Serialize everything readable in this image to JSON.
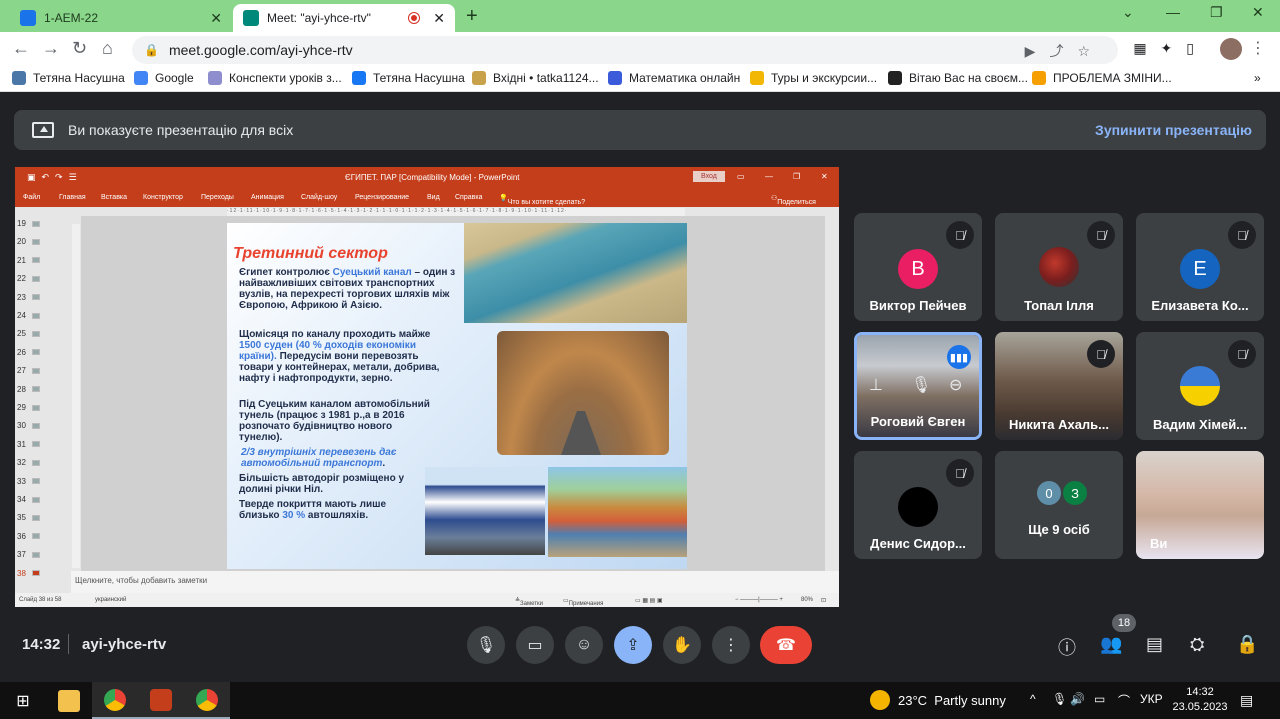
{
  "browser": {
    "tabs": [
      {
        "title": "1-АЕМ-22",
        "color": "#1a73e8"
      },
      {
        "title": "Meet: \"ayi-yhce-rtv\"",
        "color": "#00897b"
      }
    ],
    "url": "meet.google.com/ayi-yhce-rtv",
    "bookmarks": [
      {
        "label": "Тетяна Насушна",
        "color": "#4a76a8"
      },
      {
        "label": "Google",
        "color": "#4285f4"
      },
      {
        "label": "Конспекти уроків з...",
        "color": "#8e8ecf"
      },
      {
        "label": "Тетяна Насушна",
        "color": "#1877f2"
      },
      {
        "label": "Вхідні • tatka1124...",
        "color": "#c8a24a"
      },
      {
        "label": "Математика онлайн",
        "color": "#3b5bdb"
      },
      {
        "label": "Туры и экскурсии...",
        "color": "#f2b705"
      },
      {
        "label": "Вітаю Вас на своєм...",
        "color": "#222222"
      },
      {
        "label": "ПРОБЛЕМА ЗМІНИ...",
        "color": "#f59f00"
      }
    ],
    "bookmarks_more": "»"
  },
  "meet": {
    "banner_text": "Ви показуєте презентацію для всіх",
    "stop_label": "Зупинити презентацію",
    "time": "14:32",
    "meeting_code": "ayi-yhce-rtv",
    "people_count": "18",
    "participants": [
      {
        "name": "Виктор Пейчев",
        "initial": "В",
        "color": "#e91e63"
      },
      {
        "name": "Топал Ілля"
      },
      {
        "name": "Елизавета Ко...",
        "initial": "Е",
        "color": "#1565c0"
      },
      {
        "name": "Роговий Євген"
      },
      {
        "name": "Никита Ахаль..."
      },
      {
        "name": "Вадим Хімей..."
      },
      {
        "name": "Денис Сидор..."
      },
      {
        "name": "Ще 9 осіб",
        "more": [
          "0",
          "З"
        ]
      },
      {
        "name": "Ви"
      }
    ]
  },
  "ppt": {
    "window_title": "ЄГИПЕТ. ПАР [Compatibility Mode] - PowerPoint",
    "login": "Вход",
    "ribbon": [
      "Файл",
      "Главная",
      "Вставка",
      "Конструктор",
      "Переходы",
      "Анимация",
      "Слайд-шоу",
      "Рецензирование",
      "Вид",
      "Справка",
      "Что вы хотите сделать?",
      "Поделиться"
    ],
    "thumb_numbers": [
      "19",
      "20",
      "21",
      "22",
      "23",
      "24",
      "25",
      "26",
      "27",
      "28",
      "29",
      "30",
      "31",
      "32",
      "33",
      "34",
      "35",
      "36",
      "37",
      "38"
    ],
    "notes_placeholder": "Щелкните, чтобы добавить заметки",
    "status_left": "Слайд 38 из 58",
    "status_lang": "украинский",
    "status_notes": "Заметки",
    "status_comments": "Примечания",
    "zoom": "80%",
    "slide": {
      "title": "Третинний сектор",
      "p1_a": "Єгипет контролює ",
      "p1_hl": "Суецький канал",
      "p1_b": " – один з найважливіших світових транспортних вузлів, на перехресті торгових шляхів між Європою, Африкою й Азією.",
      "p2_a": "Щомісяця по каналу проходить майже ",
      "p2_hl": "1500 суден (40 % доходів економіки країни).",
      "p2_b": " Передусім вони перевозять товари у контейнерах, метали, добрива, нафту і нафтопродукти, зерно.",
      "p3": "Під Суецьким каналом автомобільний тунель (працює з 1981 р.,а в 2016 розпочато будівництво нового тунелю).",
      "p4_hl": "2/3 внутрішніх перевезень дає автомобільний транспорт",
      "p4_b": ".",
      "p5": "Більшість автодоріг розміщено у долині річки Ніл.",
      "p6_a": "Тверде покриття мають лише близько ",
      "p6_hl": "30 %",
      "p6_b": " автошляхів."
    }
  },
  "taskbar": {
    "temperature": "23°C",
    "weather": "Partly sunny",
    "language": "УКР",
    "time": "14:32",
    "date": "23.05.2023"
  }
}
